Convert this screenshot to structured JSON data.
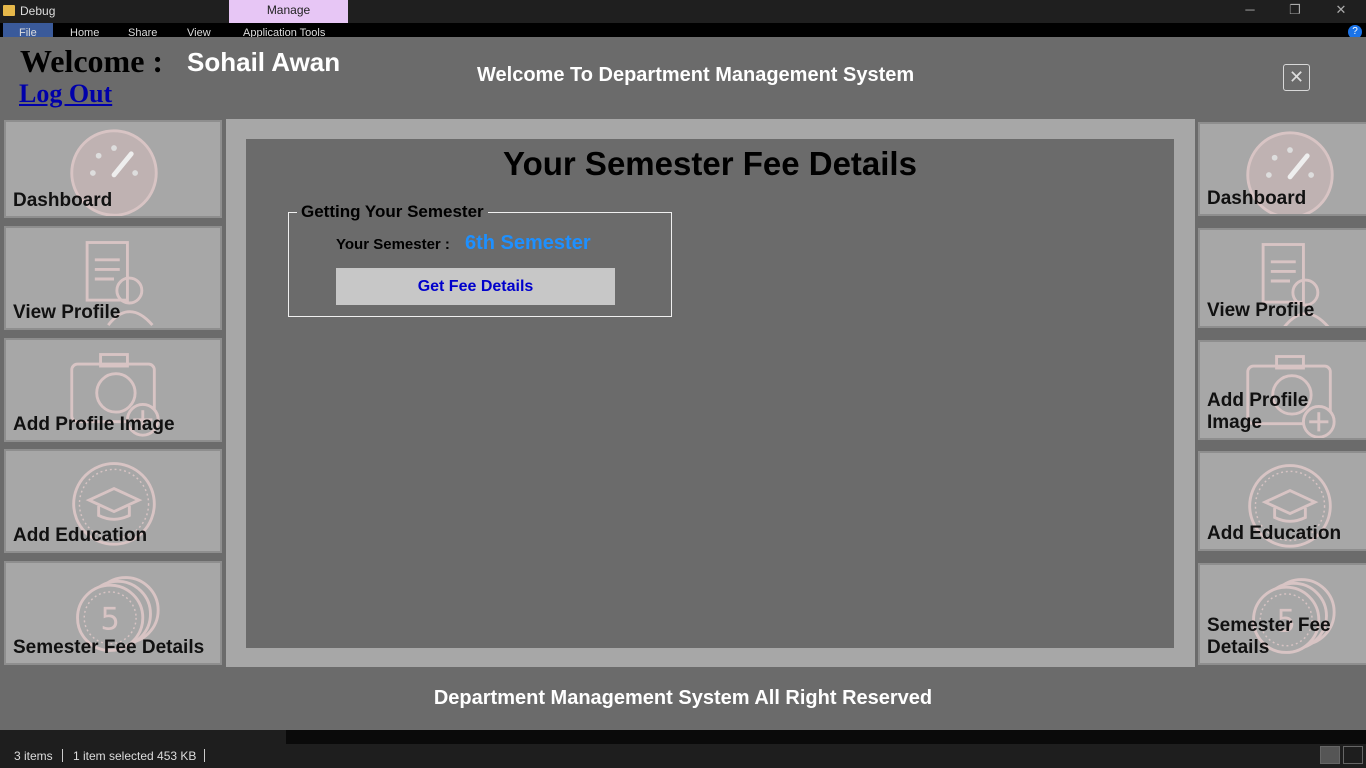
{
  "window": {
    "title": "Debug",
    "context_tab": "Manage",
    "ribbon_tabs": [
      "File",
      "Home",
      "Share",
      "View",
      "Application Tools"
    ],
    "minimize": "─",
    "restore": "❐",
    "close": "✕",
    "help": "?"
  },
  "header": {
    "welcome_label": "Welcome :",
    "user_name": "Sohail Awan",
    "logout": "Log Out",
    "system_title": "Welcome To Department Management System",
    "close_symbol": "✕"
  },
  "left_nav": [
    {
      "label": "Dashboard",
      "icon": "dashboard-gauge-icon"
    },
    {
      "label": "View Profile",
      "icon": "profile-document-icon"
    },
    {
      "label": "Add Profile Image",
      "icon": "camera-add-icon"
    },
    {
      "label": "Add Education",
      "icon": "graduation-cap-icon"
    },
    {
      "label": "Semester Fee Details",
      "icon": "coin-stack-icon"
    }
  ],
  "right_nav": [
    {
      "label": "Dashboard",
      "icon": "dashboard-gauge-icon"
    },
    {
      "label": "View Profile",
      "icon": "profile-document-icon"
    },
    {
      "label": "Add Profile Image",
      "icon": "camera-add-icon"
    },
    {
      "label": "Add Education",
      "icon": "graduation-cap-icon"
    },
    {
      "label": "Semester Fee Details",
      "icon": "coin-stack-icon"
    }
  ],
  "content": {
    "title": "Your Semester Fee Details",
    "group_title": "Getting Your Semester",
    "semester_label": "Your Semester :",
    "semester_value": "6th Semester",
    "fee_button": "Get Fee Details"
  },
  "footer": "Department Management System All Right Reserved",
  "statusbar": {
    "items": "3 items",
    "selected": "1 item selected  453 KB"
  },
  "colors": {
    "app_bg": "#6b6b6b",
    "panel_bg": "#a7a7a7",
    "accent_blue": "#1e90ff",
    "link_blue": "#0000aa",
    "manage_tab": "#e7c6f5"
  }
}
